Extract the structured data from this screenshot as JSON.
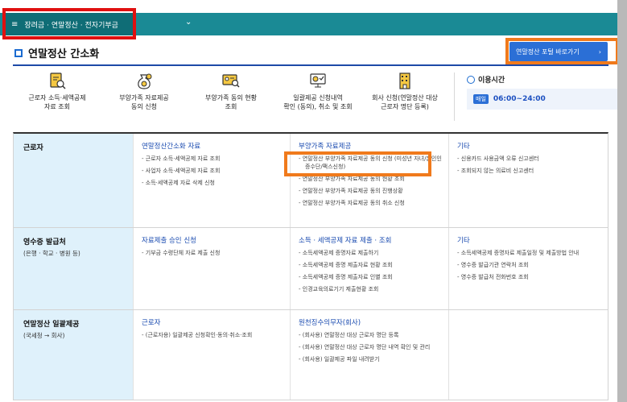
{
  "topbar": {
    "menu_label": "장려금 · 연말정산 · 전자기부금",
    "menu_icon": "hamburger-icon",
    "dropdown_icon": "chevron-down-icon",
    "color": "#1a8a95"
  },
  "page": {
    "title": "연말정산 간소화",
    "portal_button": "연말정산 포털 바로가기"
  },
  "services": [
    {
      "label": "근로자 소득·세액공제\n자료 조회",
      "icon": "document-search-icon"
    },
    {
      "label": "부양가족 자료제공\n동의 신청",
      "icon": "money-bag-icon"
    },
    {
      "label": "부양가족 동의 현황\n조회",
      "icon": "id-card-search-icon"
    },
    {
      "label": "일괄제공 신청내역\n확인 (동의), 취소 및 조회",
      "icon": "monitor-check-icon"
    },
    {
      "label": "회사 신청(연말정산 대상\n근로자 명단 등록)",
      "icon": "building-icon"
    }
  ],
  "hours": {
    "title": "이용시간",
    "badge": "매일",
    "value": "06:00~24:00"
  },
  "rows": [
    {
      "head": "근로자",
      "sub": "",
      "cols": [
        {
          "title": "연말정산간소화 자료",
          "items": [
            "근로자 소득·세액공제 자료 조회",
            "사업자 소득·세액공제 자료 조회",
            "소득·세액공제 자료 삭제 신청"
          ]
        },
        {
          "title": "부양가족 자료제공",
          "items": [
            "연말정산 부양가족 자료제공 동의 신청 (미성년 자녀/본인인증수단/팩스신청)",
            "연말정산 부양가족 자료제공 동의 현황 조회",
            "연말정산 부양가족 자료제공 동의 진행상황",
            "연말정산 부양가족 자료제공 동의 취소 신청"
          ]
        },
        {
          "title": "기타",
          "items": [
            "신용카드 사용금액 오류 신고센터",
            "조회되지 않는 의료비 신고센터"
          ]
        }
      ]
    },
    {
      "head": "영수증 발급처",
      "sub": "(은행 · 학교 · 병원 등)",
      "cols": [
        {
          "title": "자료제출 승인 신청",
          "items": [
            "기부금 수령단체 자료 제출 신청"
          ]
        },
        {
          "title": "소득 · 세액공제 자료 제출 · 조회",
          "items": [
            "소득세액공제 증명자료 제출하기",
            "소득세액공제 증명 제출자료 현황 조회",
            "소득세액공제 증명 제출자료 인별 조회",
            "인경교육의료기기 제출현황 조회"
          ]
        },
        {
          "title": "기타",
          "items": [
            "소득세액공제 증명자료 제출일정 및 제출방법 안내",
            "영수증 발급기관 연락처 조회",
            "영수증 발급처 전화번호 조회"
          ]
        }
      ]
    },
    {
      "head": "연말정산 일괄제공",
      "sub": "(국세청 → 회사)",
      "cols": [
        {
          "title": "근로자",
          "items": [
            "(근로자용) 일괄제공 신청확인·동의·취소·조회"
          ]
        },
        {
          "title": "원천징수의무자(회사)",
          "items": [
            "(회사용) 연말정산 대상 근로자 명단 등록",
            "(회사용) 연말정산 대상 근로자 명단 내역 확인 및 관리",
            "(회사용) 일괄제공 파일 내려받기"
          ]
        },
        {
          "title": "",
          "items": []
        }
      ]
    }
  ]
}
